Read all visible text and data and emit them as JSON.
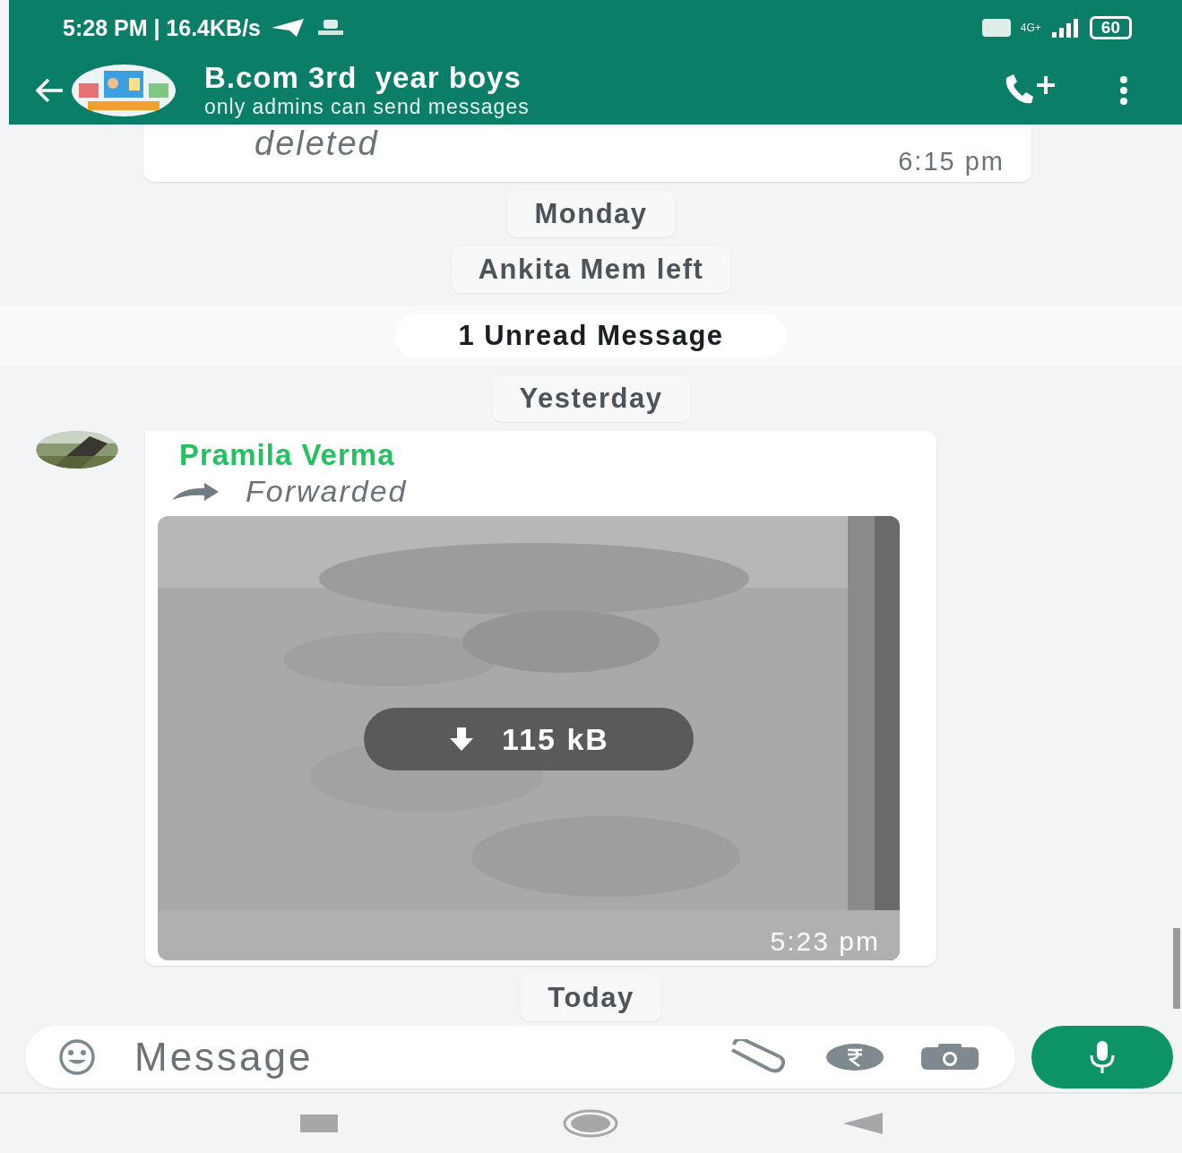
{
  "status_bar": {
    "time": "5:28 PM | 16.4KB/s",
    "network": "4G+",
    "battery": "60"
  },
  "header": {
    "title": "B.com 3rd  year boys",
    "subtitle": "only admins can send messages"
  },
  "messages": [
    {
      "kind": "deleted",
      "text": "deleted",
      "time": "6:15 pm"
    },
    {
      "kind": "chip",
      "text": "Monday"
    },
    {
      "kind": "chip",
      "text": "Ankita Mem left"
    },
    {
      "kind": "unread",
      "text": "1 Unread Message"
    },
    {
      "kind": "chip",
      "text": "Yesterday"
    },
    {
      "sender": "Pramila Verma",
      "forwarded": "Forwarded",
      "download": "115 kB",
      "time": "5:23 pm"
    },
    {
      "kind": "chip",
      "text": "Today"
    }
  ],
  "composer": {
    "placeholder": "Message"
  }
}
